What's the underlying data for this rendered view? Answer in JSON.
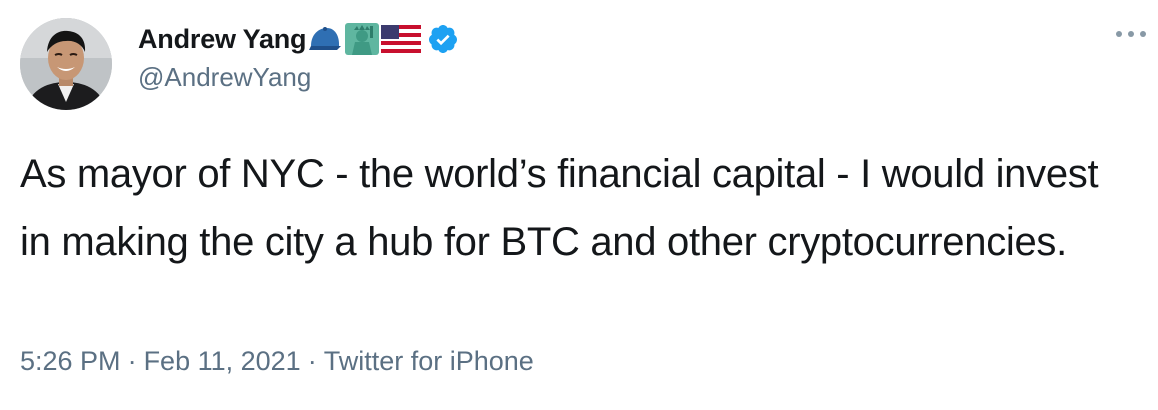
{
  "tweet": {
    "display_name": "Andrew Yang",
    "name_emojis": [
      "blue-cap-emoji",
      "statue-of-liberty-emoji",
      "us-flag-emoji"
    ],
    "verified": true,
    "handle": "@AndrewYang",
    "text": "As mayor of NYC - the world’s financial capital - I would invest in making the city a hub for BTC and other cryptocurrencies.",
    "time": "5:26 PM",
    "date": "Feb 11, 2021",
    "source": "Twitter for iPhone",
    "separator": "·"
  },
  "icons": {
    "more": "more-horizontal-icon",
    "verified": "verified-badge-icon"
  },
  "colors": {
    "text": "#14171a",
    "secondary": "#5b7083",
    "verified_blue": "#1da1f2",
    "background": "#ffffff"
  }
}
